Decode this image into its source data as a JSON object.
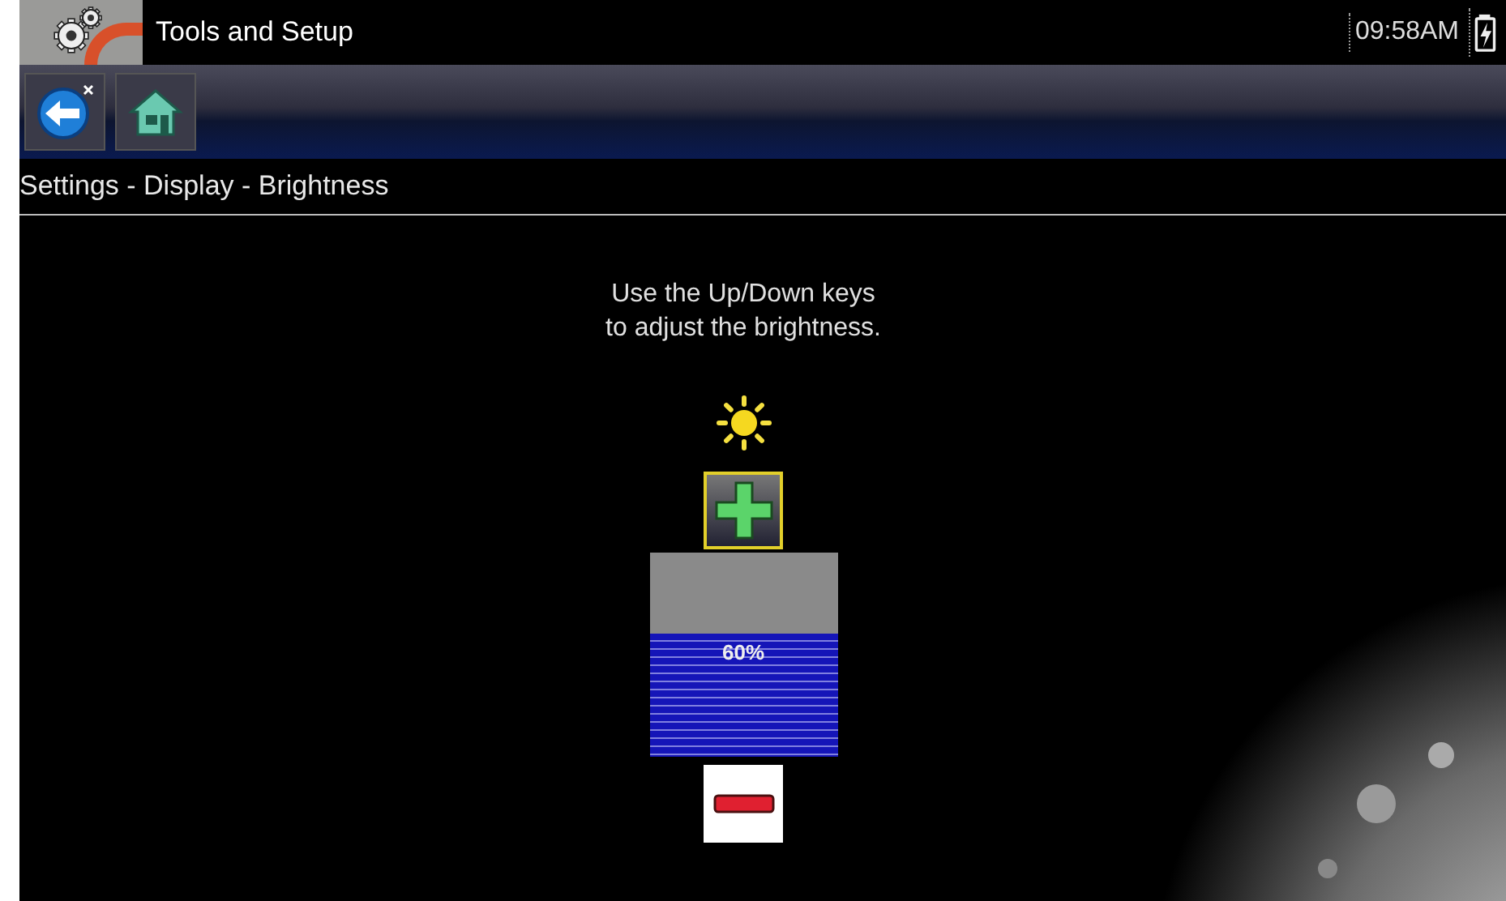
{
  "title_bar": {
    "title": "Tools and Setup",
    "time": "09:58AM"
  },
  "breadcrumb": "Settings - Display - Brightness",
  "instructions": [
    "Use the Up/Down keys",
    "to adjust the brightness."
  ],
  "brightness": {
    "level": 0.6,
    "reading": "60%"
  }
}
